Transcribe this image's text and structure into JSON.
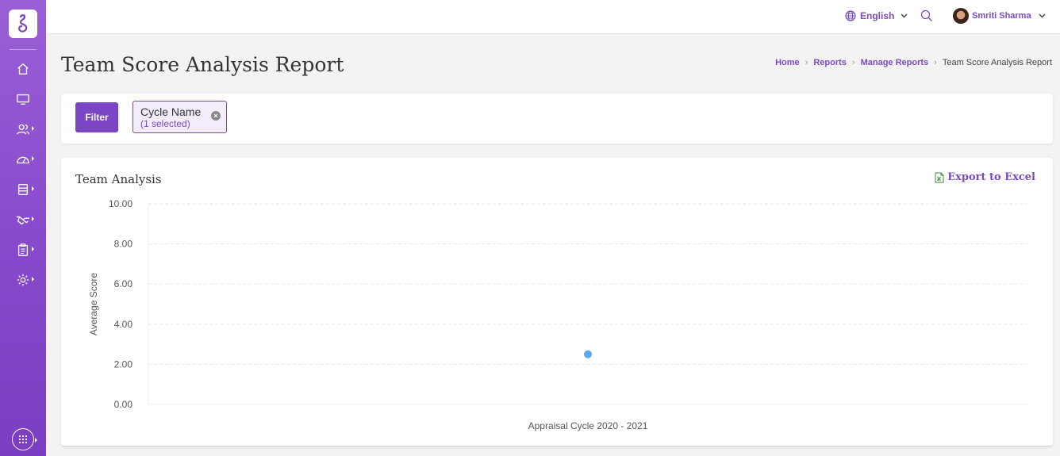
{
  "topbar": {
    "language": "English",
    "user_name": "Smriti Sharma"
  },
  "page": {
    "title": "Team Score Analysis Report",
    "breadcrumb": [
      "Home",
      "Reports",
      "Manage Reports",
      "Team Score Analysis Report"
    ]
  },
  "filter": {
    "button_label": "Filter",
    "chip": {
      "name": "Cycle Name",
      "sub": "(1 selected)"
    }
  },
  "sidebar": {
    "icons": [
      "home-icon",
      "monitor-icon",
      "users-icon",
      "gauge-icon",
      "database-icon",
      "handshake-icon",
      "clipboard-icon",
      "gear-icon"
    ],
    "apps_icon": "apps-grid-icon"
  },
  "card": {
    "title": "Team Analysis",
    "export_label": "Export to Excel"
  },
  "colors": {
    "brand": "#7b45c4",
    "point": "#5aa9ef"
  },
  "chart_data": {
    "type": "scatter",
    "title": "",
    "xlabel": "",
    "ylabel": "Average Score",
    "categories": [
      "Appraisal Cycle 2020 - 2021"
    ],
    "values": [
      2.5
    ],
    "ylim": [
      0,
      10
    ],
    "yticks": [
      "10.00",
      "8.00",
      "6.00",
      "4.00",
      "2.00",
      "0.00"
    ],
    "grid": true
  }
}
